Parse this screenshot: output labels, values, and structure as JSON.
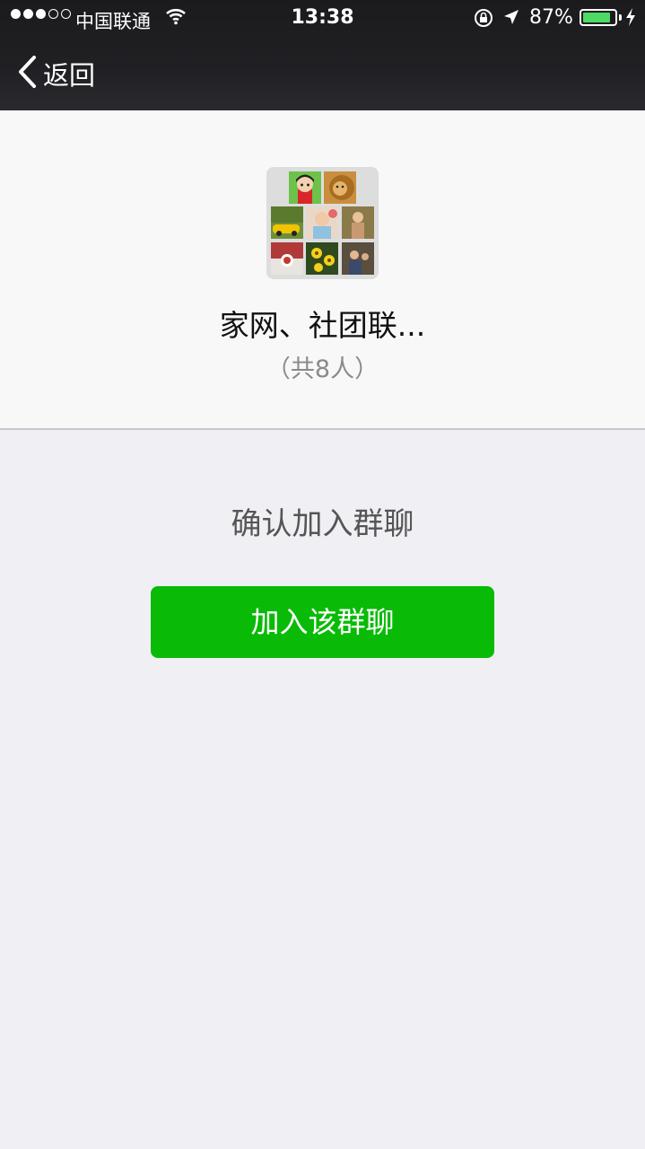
{
  "status_bar": {
    "carrier": "中国联通",
    "time": "13:38",
    "battery_percent": "87%",
    "battery_level": 0.87,
    "signal_bars": 3,
    "signal_total": 5
  },
  "nav": {
    "back_label": "返回"
  },
  "group": {
    "name": "家网、社团联...",
    "member_count": "（共8人）"
  },
  "main": {
    "confirm_text": "确认加入群聊",
    "join_button_label": "加入该群聊"
  },
  "colors": {
    "accent_green": "#09bb07",
    "battery_green": "#4cd964"
  }
}
